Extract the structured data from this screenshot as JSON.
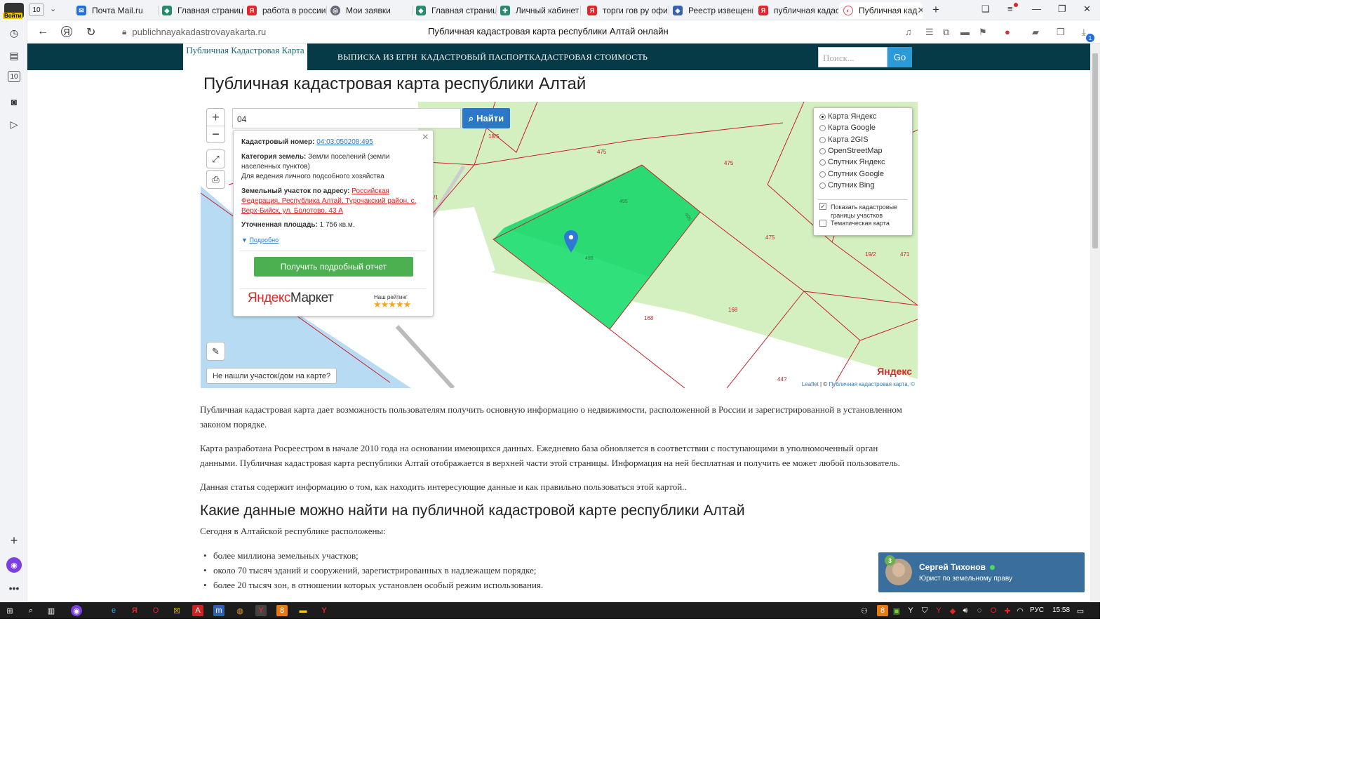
{
  "browser": {
    "tab_count": "10",
    "tabs": [
      {
        "title": "Почта Mail.ru",
        "color": "#1f6fe0"
      },
      {
        "title": "Главная страница",
        "color": "#2a8a6e"
      },
      {
        "title": "работа в россии",
        "color": "#e0262a"
      },
      {
        "title": "Мои заявки",
        "color": "#667"
      },
      {
        "title": "Главная страница",
        "color": "#2a8a6e"
      },
      {
        "title": "Личный кабинет",
        "color": "#2a8a6e"
      },
      {
        "title": "торги гов ру офи",
        "color": "#e0262a"
      },
      {
        "title": "Реестр извещени",
        "color": "#3a60b0"
      },
      {
        "title": "публичная кадаст",
        "color": "#e0262a"
      },
      {
        "title": "Публичная кад",
        "color": "#d56"
      }
    ],
    "account_label": "Войти",
    "url": "publichnayakadastrovayakarta.ru",
    "page_title": "Публичная кадастровая карта республики Алтай онлайн",
    "downloads_badge": "1"
  },
  "site": {
    "brand": "Публичная Кадастровая Карта",
    "menu": [
      "ВЫПИСКА ИЗ ЕГРН",
      "КАДАСТРОВЫЙ ПАСПОРТ",
      "КАДАСТРОВАЯ СТОИМОСТЬ"
    ],
    "search_placeholder": "Поиск...",
    "search_button": "Go",
    "heading": "Публичная кадастровая карта республики Алтай"
  },
  "map": {
    "zoom_in": "+",
    "zoom_out": "−",
    "search_value": "04",
    "find_button": "Найти",
    "popup": {
      "cadastral_label": "Кадастровый номер:",
      "cadastral_value": "04:03:050208:495",
      "category_label": "Категория земель:",
      "category_value": "Земли поселений (земли населенных пунктов)",
      "usage": "Для ведения личного подсобного хозяйства",
      "address_label": "Земельный участок по адресу:",
      "address_value": "Российская Федерация, Республика Алтай, Турочакский район, с. Верх-Бийск, ул. Болотово, 43 А",
      "area_label": "Уточненная площадь:",
      "area_value": "1 756 кв.м.",
      "more_link": "Подробно",
      "report_button": "Получить подробный отчет",
      "market_logo_a": "Яндекс",
      "market_logo_b": "Маркет",
      "rating_label": "Наш рейтинг",
      "stars": "★★★★★"
    },
    "layers": {
      "options": [
        "Карта Яндекс",
        "Карта Google",
        "Карта 2GIS",
        "OpenStreetMap",
        "Спутник Яндекс",
        "Спутник Google",
        "Спутник Bing"
      ],
      "selected": "Карта Яндекс",
      "show_borders": "Показать кадастровые границы участков",
      "thematic": "Тематическая карта"
    },
    "not_found": "Не нашли участок/дом на карте?",
    "parcel_labels": [
      "18/5",
      "475",
      "475",
      "475",
      "495",
      "495",
      "495",
      "19/2",
      "471",
      "168",
      "168",
      "44?",
      "/1"
    ],
    "attribution_leaflet": "Leaflet",
    "attribution_sep": " | © ",
    "attribution_pkk": "Публичная кадастровая карта, ©",
    "yandex_logo": "Яндекс"
  },
  "article": {
    "p1": "Публичная кадастровая карта дает возможность пользователям получить основную информацию о недвижимости, расположенной в России и зарегистрированной в установленном законом порядке.",
    "p2": "Карта разработана Росреестром в начале 2010 года на основании имеющихся данных. Ежедневно база обновляется в соответствии с поступающими в уполномоченный орган данными. Публичная кадастровая карта республики Алтай отображается в верхней части этой страницы. Информация на ней бесплатная и получить ее может любой пользователь.",
    "p3": "Данная статья содержит информацию о том, как находить интересующие данные и как правильно пользоваться этой картой..",
    "h2": "Какие данные можно найти на публичной кадастровой карте республики Алтай",
    "p4": "Сегодня в Алтайской республике расположены:",
    "bullets": [
      "более миллиона земельных участков;",
      "около 70 тысяч зданий и сооружений, зарегистрированных в надлежащем порядке;",
      "более 20 тысяч зон, в отношении которых установлен особый режим использования."
    ]
  },
  "chat": {
    "badge": "3",
    "name": "Сергей Тихонов",
    "role": "Юрист по земельному праву"
  },
  "taskbar": {
    "lang": "РУС",
    "time": "15:58"
  }
}
